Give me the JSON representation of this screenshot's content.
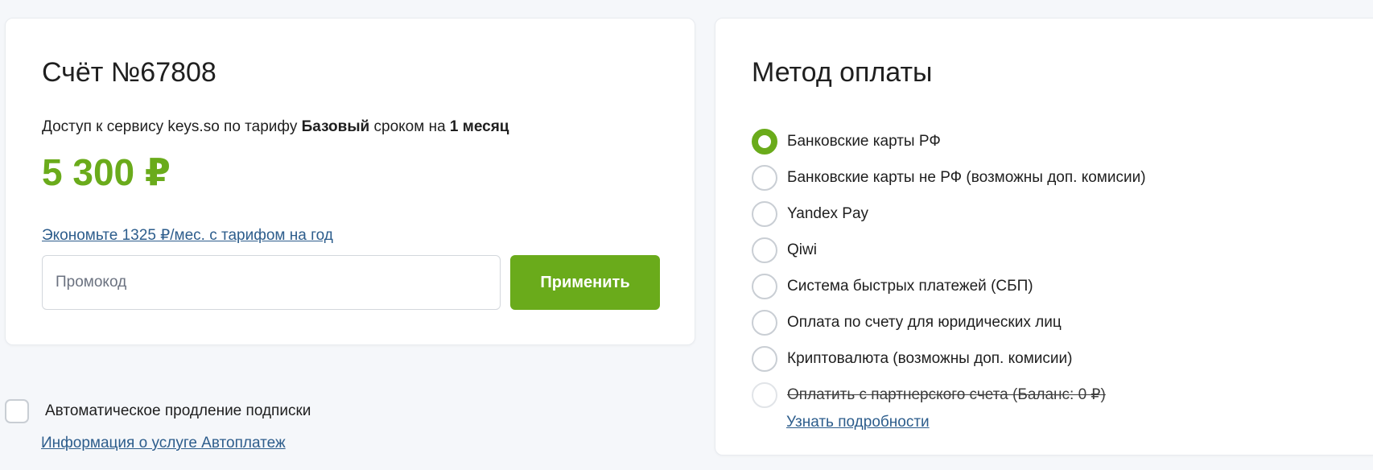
{
  "invoice": {
    "title": "Счёт №67808",
    "desc_prefix": "Доступ к сервису keys.so по тарифу ",
    "plan": "Базовый",
    "desc_middle": " сроком на ",
    "period": "1 месяц",
    "price": "5 300 ₽",
    "save_link": "Экономьте 1325 ₽/мес. с тарифом на год",
    "promo_placeholder": "Промокод",
    "apply_label": "Применить"
  },
  "auto_renew": {
    "label": "Автоматическое продление подписки",
    "checked": false,
    "info_link": "Информация о услуге Автоплатеж"
  },
  "payment": {
    "title": "Метод оплаты",
    "methods": [
      {
        "label": "Банковские карты РФ",
        "selected": true,
        "disabled": false
      },
      {
        "label": "Банковские карты не РФ (возможны доп. комисии)",
        "selected": false,
        "disabled": false
      },
      {
        "label": "Yandex Pay",
        "selected": false,
        "disabled": false
      },
      {
        "label": "Qiwi",
        "selected": false,
        "disabled": false
      },
      {
        "label": "Система быстрых платежей (СБП)",
        "selected": false,
        "disabled": false
      },
      {
        "label": "Оплата по счету для юридических лиц",
        "selected": false,
        "disabled": false
      },
      {
        "label": "Криптовалюта (возможны доп. комисии)",
        "selected": false,
        "disabled": false
      },
      {
        "label": "Оплатить с партнерского счета (Баланс: 0 ₽)",
        "selected": false,
        "disabled": true
      }
    ],
    "details_link": "Узнать подробности"
  },
  "colors": {
    "accent": "#6aab1b",
    "link": "#2d5d8c",
    "background": "#f5f7fa"
  }
}
